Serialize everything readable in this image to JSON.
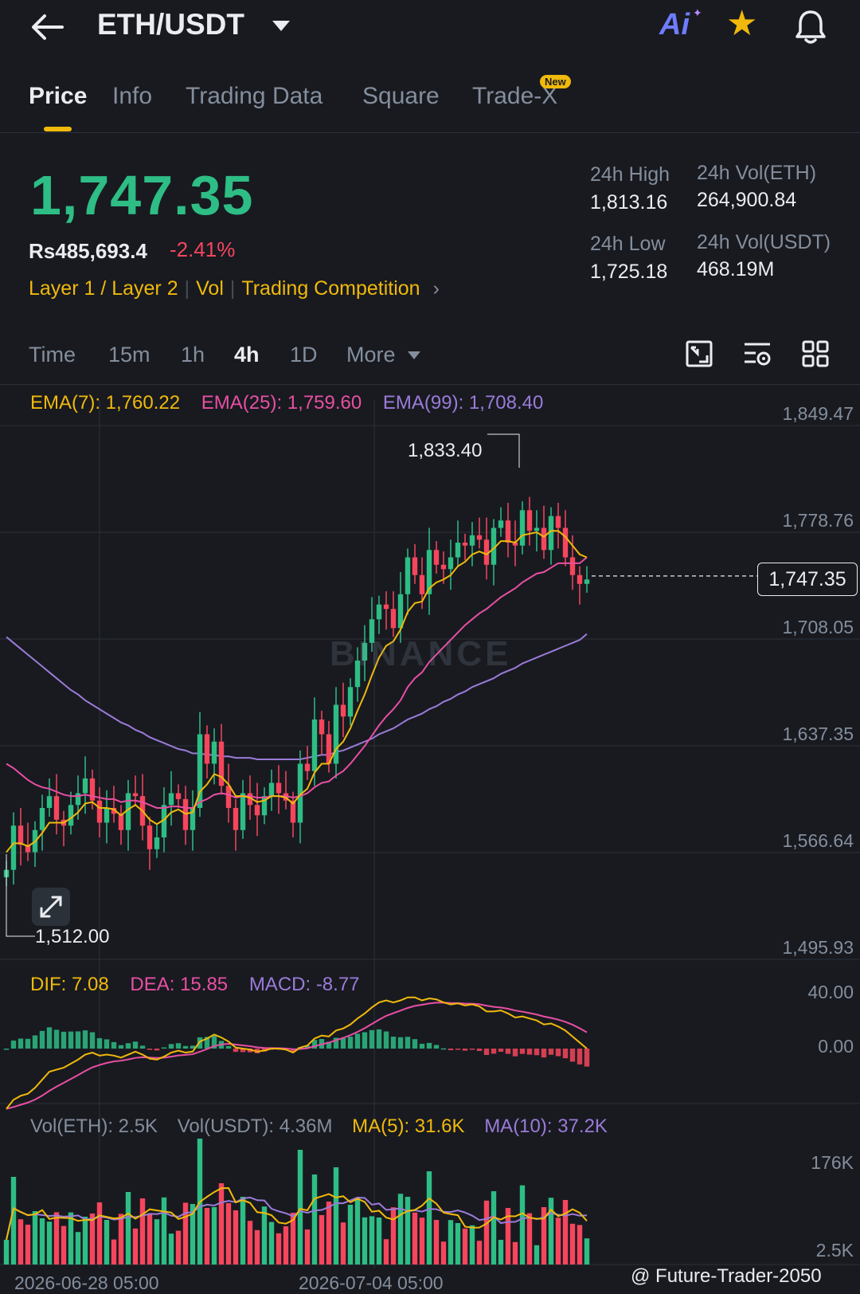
{
  "header": {
    "pair": "ETH/USDT",
    "ai_label": "Ai",
    "icons": [
      "back-arrow-icon",
      "dropdown-caret-icon",
      "ai-icon",
      "star-icon",
      "bell-icon"
    ]
  },
  "tabs": [
    {
      "label": "Price",
      "active": true
    },
    {
      "label": "Info"
    },
    {
      "label": "Trading Data"
    },
    {
      "label": "Square"
    },
    {
      "label": "Trade-X",
      "badge": "New"
    }
  ],
  "ticker": {
    "last_price": "1,747.35",
    "fiat_price": "Rs485,693.4",
    "change_pct": "-2.41%",
    "tags": [
      "Layer 1 / Layer 2",
      "Vol",
      "Trading Competition"
    ],
    "high_label": "24h High",
    "high_value": "1,813.16",
    "low_label": "24h Low",
    "low_value": "1,725.18",
    "vol_eth_label": "24h Vol(ETH)",
    "vol_eth_value": "264,900.84",
    "vol_usdt_label": "24h Vol(USDT)",
    "vol_usdt_value": "468.19M"
  },
  "timeframes": {
    "time": "Time",
    "m15": "15m",
    "h1": "1h",
    "h4": "4h",
    "d1": "1D",
    "more": "More",
    "active": "4h"
  },
  "indicators": {
    "ema7": "EMA(7): 1,760.22",
    "ema25": "EMA(25): 1,759.60",
    "ema99": "EMA(99): 1,708.40",
    "dif": "DIF: 7.08",
    "dea": "DEA: 15.85",
    "macd": "MACD: -8.77",
    "vol_eth": "Vol(ETH): 2.5K",
    "vol_usdt": "Vol(USDT): 4.36M",
    "ma5": "MA(5): 31.6K",
    "ma10": "MA(10): 37.2K"
  },
  "colors": {
    "up": "#2ebd85",
    "down": "#f6465d",
    "accent": "#f0b90b",
    "ema7": "#f0b90b",
    "ema25": "#e84fa3",
    "ema99": "#9b7bd8"
  },
  "chart_data": {
    "type": "candlestick",
    "price_axis_ticks": [
      "1,849.47",
      "1,778.76",
      "1,708.05",
      "1,637.35",
      "1,566.64",
      "1,495.93"
    ],
    "macd_axis_ticks": [
      "40.00",
      "0.00"
    ],
    "volume_axis_ticks": [
      "176K",
      "2.5K"
    ],
    "x_tick_labels": [
      "2026-06-28 05:00",
      "2026-07-04 05:00"
    ],
    "last_price": "1,747.35",
    "period_high": "1,833.40",
    "period_low": "1,512.00",
    "ylim": [
      1495.93,
      1849.47
    ],
    "closes": [
      1548,
      1578,
      1565,
      1560,
      1575,
      1590,
      1598,
      1582,
      1578,
      1592,
      1600,
      1610,
      1595,
      1580,
      1590,
      1586,
      1575,
      1600,
      1598,
      1578,
      1562,
      1570,
      1592,
      1600,
      1596,
      1575,
      1590,
      1640,
      1620,
      1635,
      1605,
      1590,
      1575,
      1600,
      1592,
      1585,
      1598,
      1607,
      1600,
      1595,
      1580,
      1620,
      1615,
      1650,
      1640,
      1620,
      1660,
      1652,
      1672,
      1690,
      1702,
      1718,
      1728,
      1725,
      1712,
      1735,
      1760,
      1748,
      1735,
      1765,
      1755,
      1752,
      1760,
      1770,
      1768,
      1775,
      1772,
      1755,
      1780,
      1785,
      1770,
      1768,
      1792,
      1778,
      1780,
      1765,
      1788,
      1780,
      1760,
      1748,
      1742,
      1745
    ],
    "ema7": [
      1560,
      1566,
      1566,
      1564,
      1567,
      1573,
      1580,
      1580,
      1580,
      1583,
      1587,
      1593,
      1594,
      1590,
      1590,
      1589,
      1585,
      1589,
      1592,
      1588,
      1582,
      1579,
      1582,
      1587,
      1589,
      1586,
      1587,
      1601,
      1606,
      1613,
      1611,
      1606,
      1598,
      1598,
      1597,
      1594,
      1595,
      1598,
      1598,
      1597,
      1593,
      1599,
      1603,
      1614,
      1620,
      1620,
      1630,
      1635,
      1644,
      1656,
      1667,
      1680,
      1692,
      1700,
      1703,
      1711,
      1723,
      1729,
      1730,
      1739,
      1743,
      1745,
      1748,
      1754,
      1757,
      1762,
      1764,
      1762,
      1766,
      1771,
      1771,
      1770,
      1775,
      1776,
      1777,
      1774,
      1778,
      1778,
      1774,
      1768,
      1762,
      1760
    ],
    "ema25": [
      1620,
      1617,
      1613,
      1609,
      1606,
      1604,
      1603,
      1601,
      1599,
      1598,
      1598,
      1599,
      1598,
      1597,
      1596,
      1596,
      1594,
      1595,
      1595,
      1594,
      1592,
      1590,
      1590,
      1591,
      1591,
      1590,
      1590,
      1594,
      1596,
      1599,
      1600,
      1599,
      1597,
      1598,
      1598,
      1597,
      1597,
      1598,
      1598,
      1598,
      1597,
      1598,
      1600,
      1604,
      1607,
      1608,
      1612,
      1615,
      1620,
      1626,
      1632,
      1639,
      1646,
      1652,
      1657,
      1663,
      1672,
      1678,
      1682,
      1689,
      1694,
      1699,
      1704,
      1709,
      1714,
      1718,
      1722,
      1725,
      1729,
      1733,
      1736,
      1739,
      1743,
      1746,
      1749,
      1750,
      1753,
      1756,
      1756,
      1756,
      1756,
      1760
    ],
    "ema99": [
      1706,
      1702,
      1698,
      1694,
      1690,
      1686,
      1682,
      1678,
      1674,
      1670,
      1667,
      1663,
      1660,
      1657,
      1654,
      1651,
      1648,
      1646,
      1643,
      1641,
      1638,
      1636,
      1634,
      1632,
      1630,
      1629,
      1627,
      1627,
      1626,
      1626,
      1625,
      1625,
      1624,
      1624,
      1624,
      1623,
      1623,
      1623,
      1623,
      1623,
      1623,
      1623,
      1624,
      1625,
      1626,
      1626,
      1628,
      1629,
      1631,
      1633,
      1635,
      1637,
      1640,
      1642,
      1644,
      1647,
      1650,
      1652,
      1654,
      1657,
      1659,
      1662,
      1664,
      1667,
      1669,
      1672,
      1674,
      1676,
      1678,
      1681,
      1683,
      1685,
      1688,
      1690,
      1692,
      1694,
      1696,
      1698,
      1700,
      1702,
      1704,
      1708
    ]
  },
  "watermark": "BINANCE",
  "credit": "@ Future-Trader-2050"
}
